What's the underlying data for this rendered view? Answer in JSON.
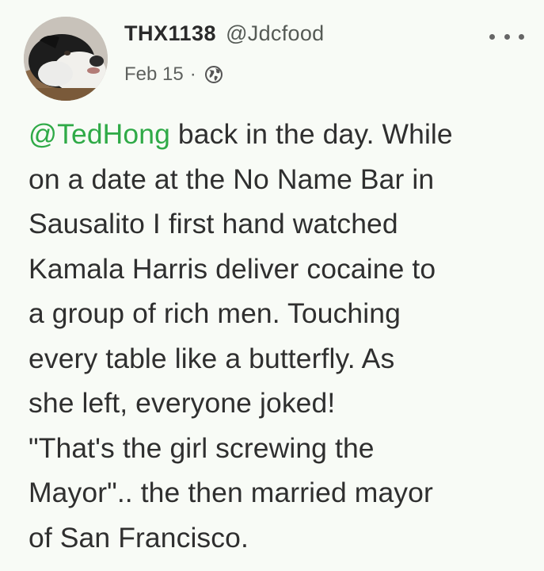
{
  "author": {
    "display_name": "THX1138",
    "handle": "@Jdcfood",
    "avatar_icon": "dog-avatar"
  },
  "meta": {
    "date": "Feb 15",
    "separator": "·",
    "visibility_icon": "globe-icon"
  },
  "menu": {
    "icon": "more-options-icon"
  },
  "post": {
    "mention": "@TedHong",
    "lines": [
      " back in the day. While",
      "on a date at the No Name Bar in",
      "Sausalito I first hand watched",
      "Kamala Harris deliver cocaine to",
      "a group of rich men. Touching",
      "every table like a butterfly. As",
      "she left, everyone joked!",
      "\"That's the girl screwing the",
      "Mayor\".. the then married mayor",
      "of San Francisco."
    ]
  },
  "colors": {
    "background": "#f8fbf6",
    "mention": "#2faa47",
    "text": "#2f2f2f"
  }
}
